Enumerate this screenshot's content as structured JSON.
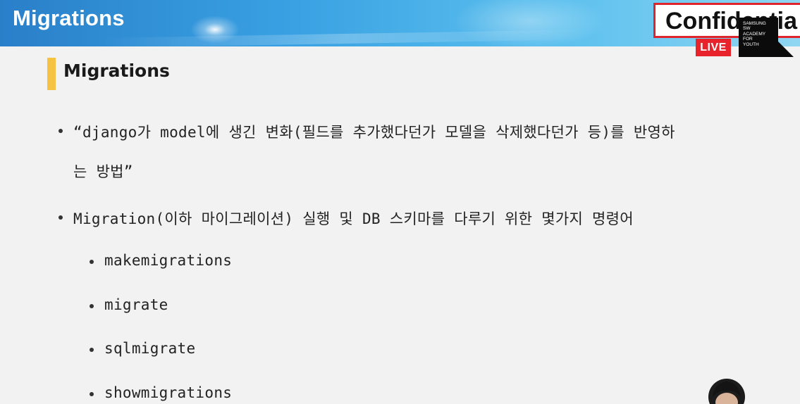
{
  "header": {
    "title": "Migrations"
  },
  "overlay": {
    "confidential_text": "Confidentia",
    "live_label": "LIVE",
    "academy_lines": [
      "SAMSUNG",
      "SW",
      "ACADEMY",
      "FOR",
      "YOUTH"
    ]
  },
  "slide": {
    "section_title": "Migrations",
    "bullet1": {
      "line1": "“django가 model에 생긴 변화(필드를 추가했다던가 모델을 삭제했다던가 등)를 반영하",
      "line2": "는 방법”"
    },
    "bullet2": {
      "text": "Migration(이하 마이그레이션) 실행 및 DB 스키마를 다루기 위한 몇가지 명령어"
    },
    "commands": [
      "makemigrations",
      "migrate",
      "sqlmigrate",
      "showmigrations"
    ]
  },
  "colors": {
    "header_gradient_start": "#2a7fc9",
    "header_gradient_end": "#8fd6f2",
    "accent_bar": "#f5c242",
    "live_red": "#e8232b",
    "background": "#f2f2f2"
  }
}
